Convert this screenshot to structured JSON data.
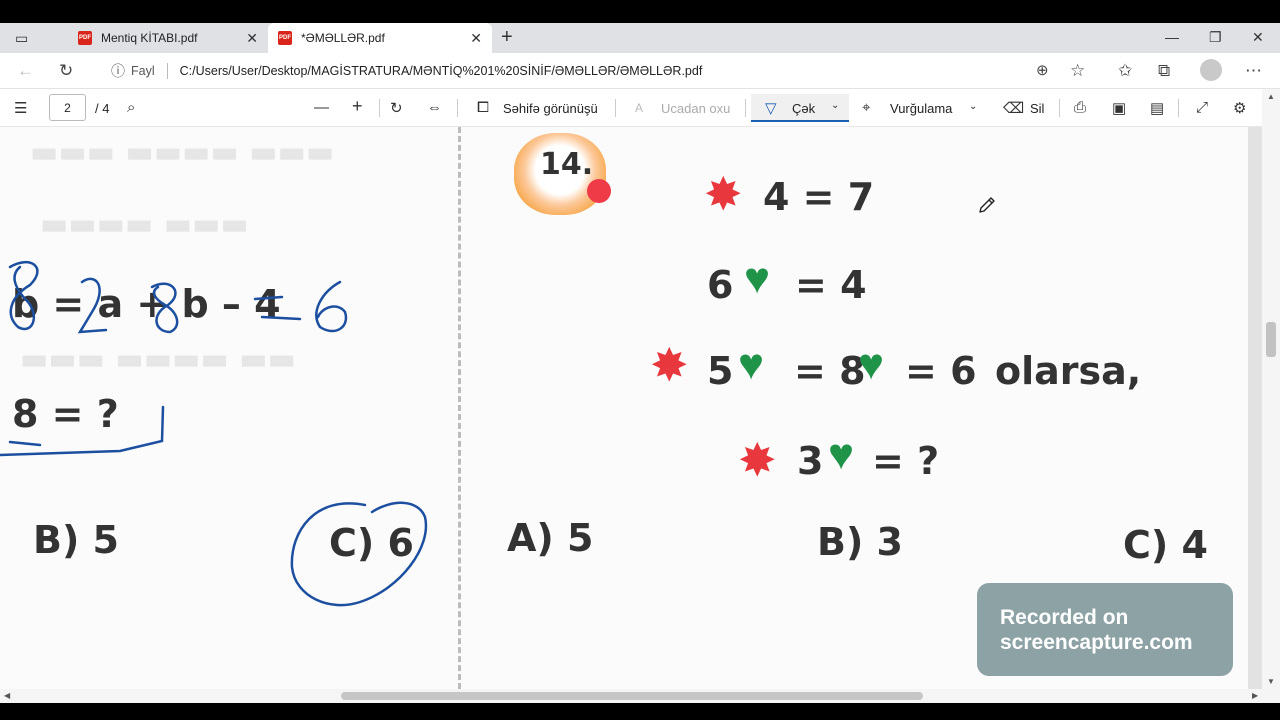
{
  "tabs": [
    {
      "title": "Mentiq KİTABI.pdf",
      "icon": "pdf-icon",
      "badge": "PDF"
    },
    {
      "title": "*ƏMƏLLƏR.pdf",
      "icon": "pdf-icon",
      "badge": "PDF"
    }
  ],
  "address": {
    "info_label": "Fayl",
    "url": "C:/Users/User/Desktop/MAGİSTRATURA/MƏNTİQ%201%20SİNİF/ƏMƏLLƏR/ƏMƏLLƏR.pdf"
  },
  "toolbar": {
    "page_current": "2",
    "page_total": "/ 4",
    "page_view": "Səhifə görünüşü",
    "read_aloud": "Ucadan oxu",
    "draw": "Çək",
    "highlight": "Vurğulama",
    "erase": "Sil"
  },
  "left_page": {
    "equation_tail": "b = a + b – 4",
    "handwritten": [
      "8",
      "2",
      "8",
      "6"
    ],
    "question": "8 = ?",
    "option_b": "B) 5",
    "option_c": "C) 6"
  },
  "problem": {
    "number": "14.",
    "line1_rhs": "4 = 7",
    "line2_lhs": "6",
    "line2_rhs": "= 4",
    "line3_a": "5",
    "line3_eq1": "= 8",
    "line3_eq2": "= 6",
    "line3_word": "olarsa,",
    "line4_a": "3",
    "line4_q": "= ?",
    "options": [
      "A) 5",
      "B) 3",
      "C) 4"
    ]
  },
  "watermark": [
    "Recorded on",
    "screencapture.com"
  ],
  "colors": {
    "star": "#e8383d",
    "heart": "#1f9448",
    "ink": "#1c4fa0"
  }
}
